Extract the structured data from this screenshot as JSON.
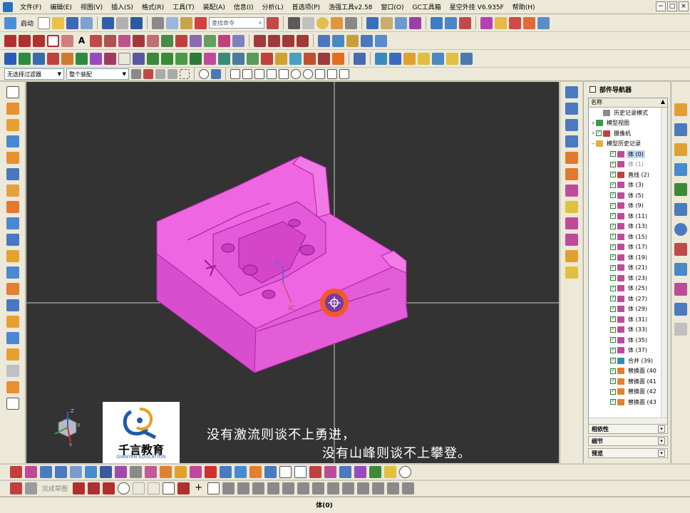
{
  "menubar": {
    "items": [
      "文件(F)",
      "编辑(E)",
      "视图(V)",
      "插入(S)",
      "格式(R)",
      "工具(T)",
      "装配(A)",
      "信息(I)",
      "分析(L)",
      "首选项(P)",
      "浩强工具v2.58",
      "窗口(O)",
      "GC工具箱",
      "星空外挂 V6.935F",
      "帮助(H)"
    ],
    "window_controls": [
      "−",
      "□",
      "×"
    ]
  },
  "toolbar1": {
    "start_label": "启动",
    "command_search_placeholder": "查找命令"
  },
  "filter_row": {
    "selection_filter": "无选择过滤器",
    "assembly_scope": "整个装配"
  },
  "viewport": {
    "axis_labels": {
      "zc": "ZC",
      "xc": "XC",
      "triad_x": "X",
      "triad_y": "Y",
      "triad_z": "Z"
    },
    "colors": {
      "background": "#333333",
      "part_fill": "#ee66e2",
      "part_edge": "#b224a7"
    }
  },
  "navigator": {
    "title": "部件导航器",
    "column_header": "名称",
    "rows": [
      {
        "label": "历史记录模式",
        "type": "clock",
        "indent": 1
      },
      {
        "label": "模型视图",
        "type": "view",
        "indent": 0,
        "expander": "+"
      },
      {
        "label": "摄像机",
        "type": "camera",
        "indent": 0,
        "expander": "+"
      },
      {
        "label": "模型历史记录",
        "type": "folder",
        "indent": 0,
        "expander": "−"
      },
      {
        "label": "体 (0)",
        "type": "body",
        "indent": 2,
        "selected": true
      },
      {
        "label": "体 (1)",
        "type": "body",
        "indent": 2,
        "dim": true
      },
      {
        "label": "直线 (2)",
        "type": "line",
        "indent": 2
      },
      {
        "label": "体 (3)",
        "type": "body",
        "indent": 2
      },
      {
        "label": "体 (5)",
        "type": "body",
        "indent": 2
      },
      {
        "label": "体 (9)",
        "type": "body",
        "indent": 2
      },
      {
        "label": "体 (11)",
        "type": "body",
        "indent": 2
      },
      {
        "label": "体 (13)",
        "type": "body",
        "indent": 2
      },
      {
        "label": "体 (15)",
        "type": "body",
        "indent": 2
      },
      {
        "label": "体 (17)",
        "type": "body",
        "indent": 2
      },
      {
        "label": "体 (19)",
        "type": "body",
        "indent": 2
      },
      {
        "label": "体 (21)",
        "type": "body",
        "indent": 2
      },
      {
        "label": "体 (23)",
        "type": "body",
        "indent": 2
      },
      {
        "label": "体 (25)",
        "type": "body",
        "indent": 2
      },
      {
        "label": "体 (27)",
        "type": "body",
        "indent": 2
      },
      {
        "label": "体 (29)",
        "type": "body",
        "indent": 2
      },
      {
        "label": "体 (31)",
        "type": "body",
        "indent": 2
      },
      {
        "label": "体 (33)",
        "type": "body",
        "indent": 2
      },
      {
        "label": "体 (35)",
        "type": "body",
        "indent": 2
      },
      {
        "label": "体 (37)",
        "type": "body",
        "indent": 2
      },
      {
        "label": "合并 (39)",
        "type": "unite",
        "indent": 2
      },
      {
        "label": "替换面 (40",
        "type": "replace",
        "indent": 2
      },
      {
        "label": "替换面 (41",
        "type": "replace",
        "indent": 2
      },
      {
        "label": "替换面 (42",
        "type": "replace",
        "indent": 2
      },
      {
        "label": "替换面 (43",
        "type": "replace",
        "indent": 2
      }
    ],
    "panels": [
      "相依性",
      "细节",
      "预览"
    ]
  },
  "watermark": {
    "brand": "千言教育",
    "brand_en": "QIANYAN EDUCATION"
  },
  "caption": {
    "line1": "没有激流则谈不上勇进，",
    "line2": "没有山峰则谈不上攀登。"
  },
  "bottom_toolbar": {
    "sketch_label": "完成草图"
  },
  "status": {
    "text": "体(0)"
  }
}
